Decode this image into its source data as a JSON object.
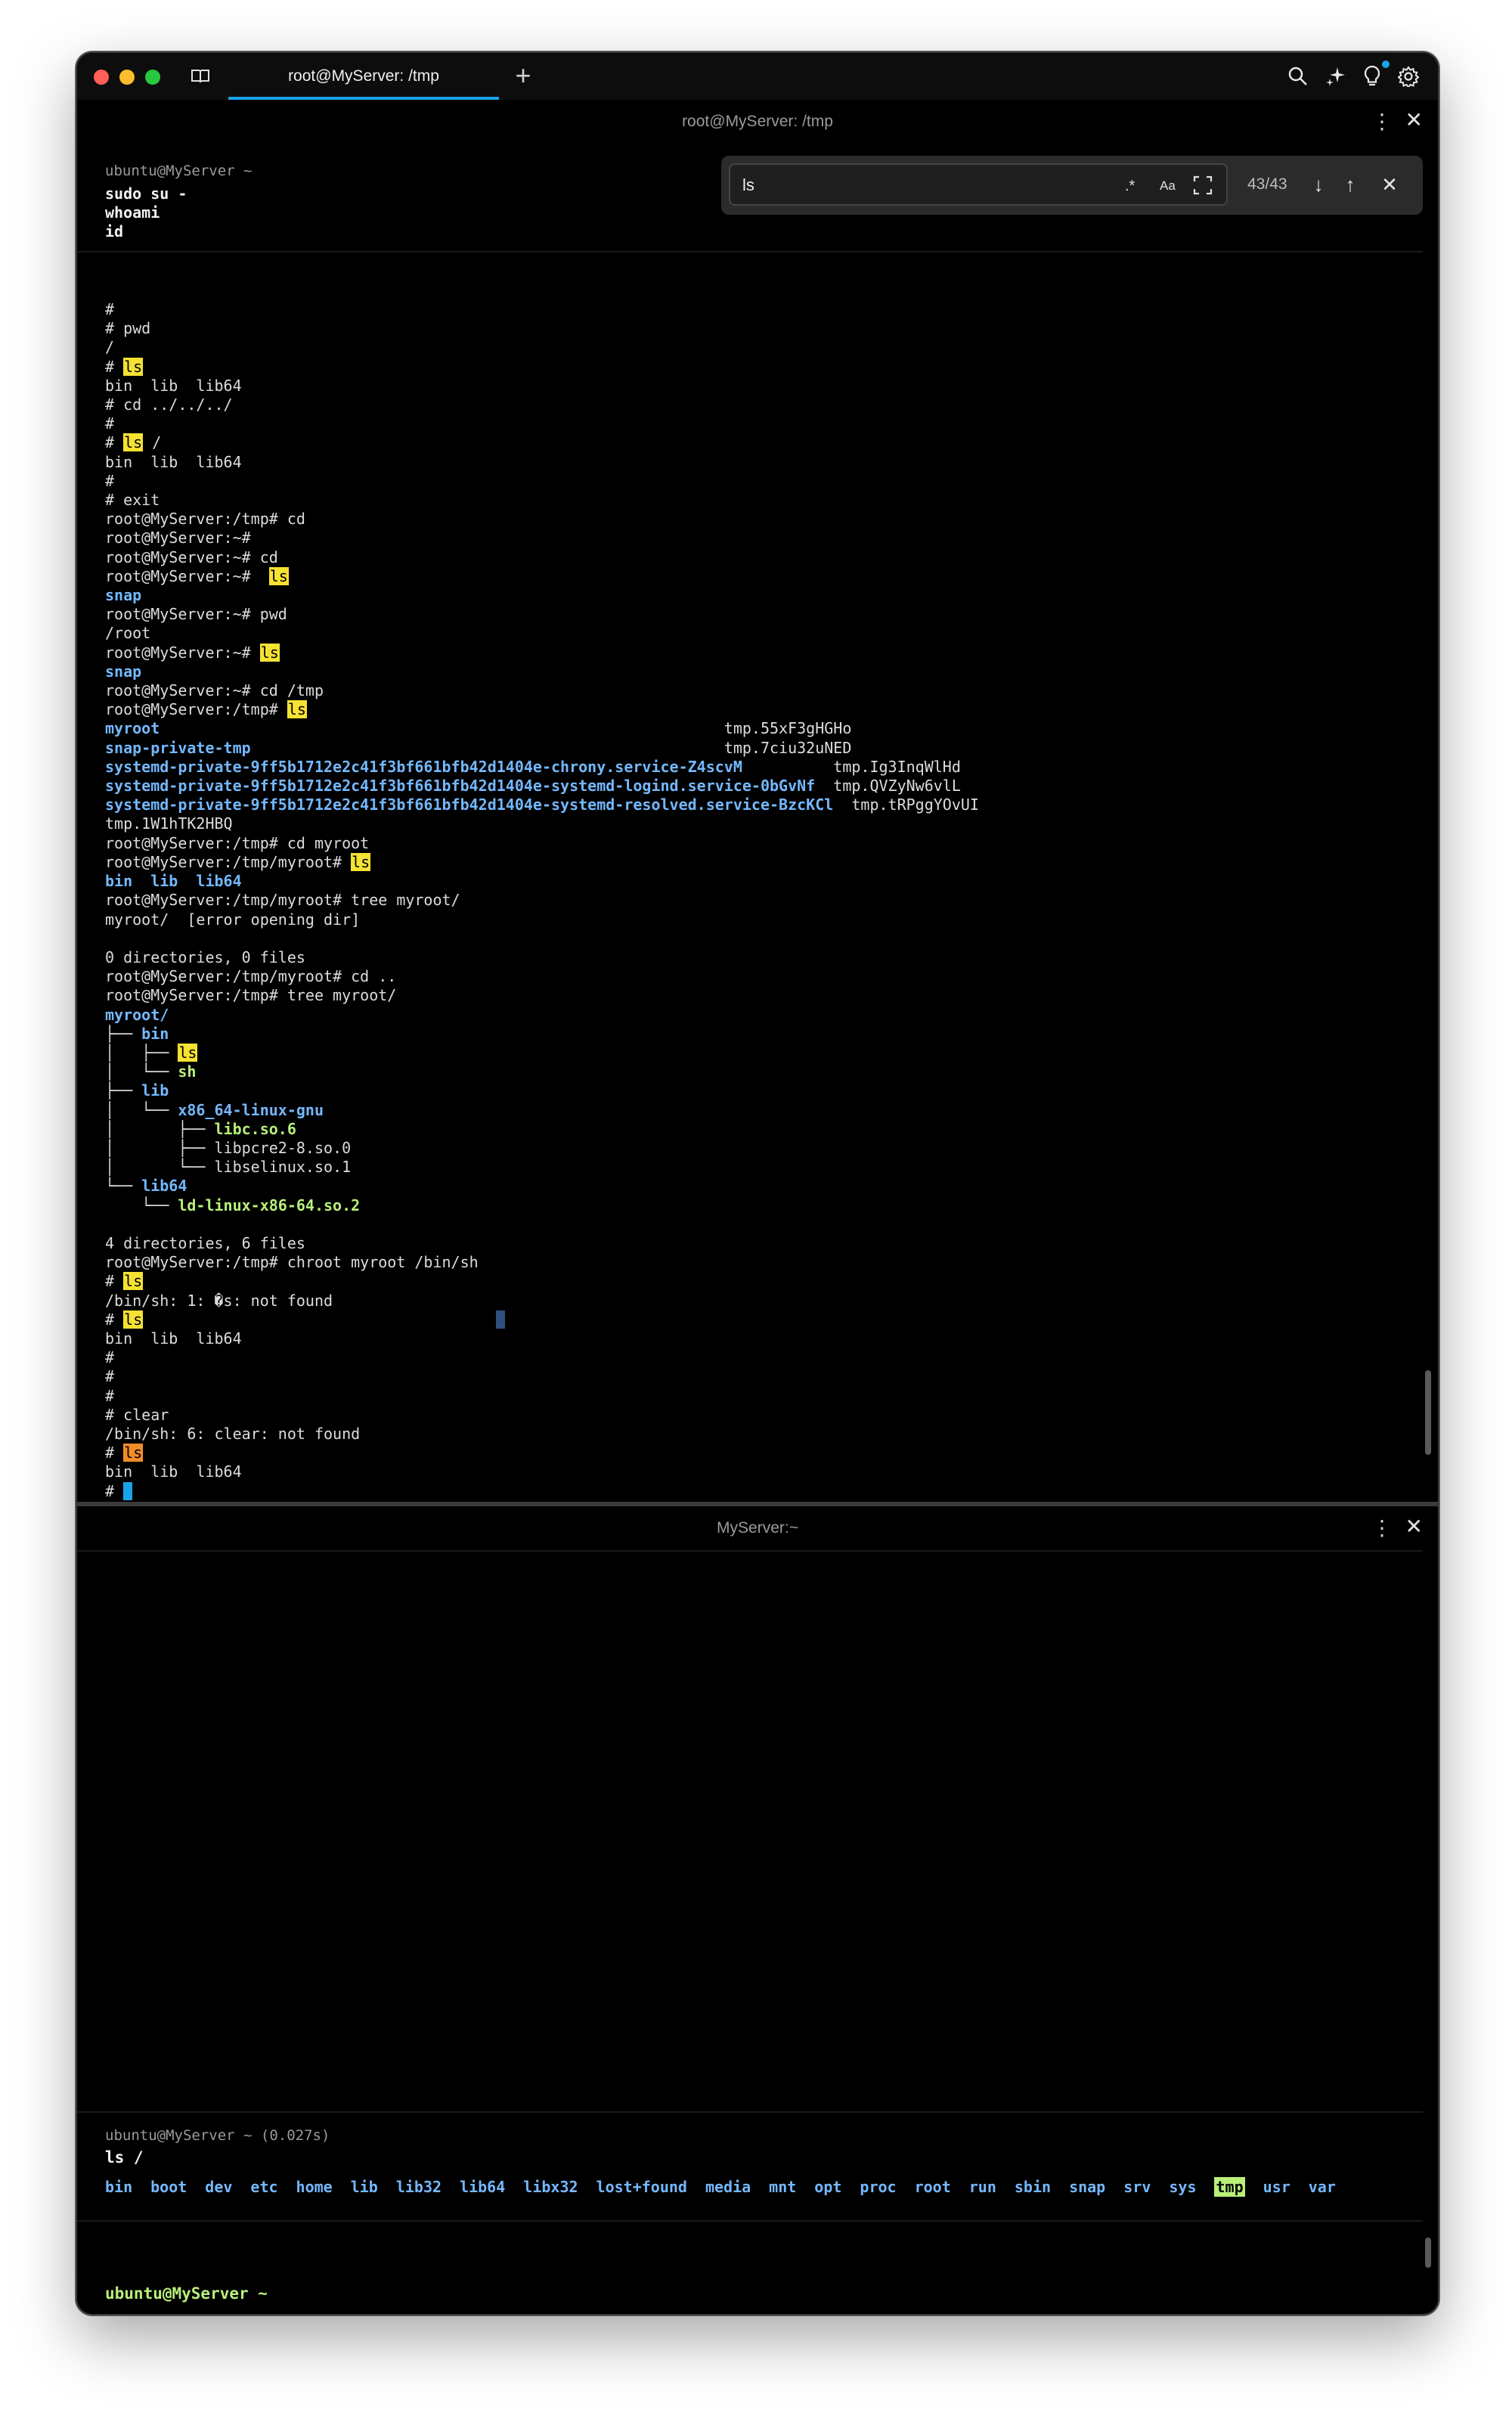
{
  "app": {
    "tab_title": "root@MyServer: /tmp",
    "new_tab_label": "+"
  },
  "icons": {
    "sidebar": "sidebar-icon",
    "search": "search-icon",
    "ai": "sparkle-icon",
    "tips": "lightbulb-icon",
    "settings": "gear-icon"
  },
  "colors": {
    "accent": "#1aa3e8",
    "directory": "#74b8ff",
    "executable": "#b8f07a",
    "match_highlight": "#f5e232",
    "current_match": "#f28c28"
  },
  "top_pane": {
    "title": "root@MyServer: /tmp",
    "block1": {
      "prompt": "ubuntu@MyServer ~",
      "commands": [
        "sudo su -",
        "whoami",
        "id"
      ]
    }
  },
  "find_bar": {
    "query": "ls",
    "regex_label": ".*",
    "case_label": "Aa",
    "count": "43/43"
  },
  "terminal_lines": [
    [
      {
        "t": "#"
      }
    ],
    [
      {
        "t": "# pwd"
      }
    ],
    [
      {
        "t": "/"
      }
    ],
    [
      {
        "t": "# "
      },
      {
        "t": "ls",
        "c": "hl"
      }
    ],
    [
      {
        "t": "bin  lib  lib64"
      }
    ],
    [
      {
        "t": "# cd ../../../"
      }
    ],
    [
      {
        "t": "#"
      }
    ],
    [
      {
        "t": "# "
      },
      {
        "t": "ls",
        "c": "hl"
      },
      {
        "t": " /"
      }
    ],
    [
      {
        "t": "bin  lib  lib64"
      }
    ],
    [
      {
        "t": "#"
      }
    ],
    [
      {
        "t": "# exit"
      }
    ],
    [
      {
        "t": "root@MyServer:/tmp# cd"
      }
    ],
    [
      {
        "t": "root@MyServer:~#"
      }
    ],
    [
      {
        "t": "root@MyServer:~# cd"
      }
    ],
    [
      {
        "t": "root@MyServer:~#  "
      },
      {
        "t": "ls",
        "c": "hl"
      }
    ],
    [
      {
        "t": "snap",
        "c": "b"
      }
    ],
    [
      {
        "t": "root@MyServer:~# pwd"
      }
    ],
    [
      {
        "t": "/root"
      }
    ],
    [
      {
        "t": "root@MyServer:~# "
      },
      {
        "t": "ls",
        "c": "hl"
      }
    ],
    [
      {
        "t": "snap",
        "c": "b"
      }
    ],
    [
      {
        "t": "root@MyServer:~# cd /tmp"
      }
    ],
    [
      {
        "t": "root@MyServer:/tmp# "
      },
      {
        "t": "ls",
        "c": "hl"
      }
    ],
    [
      {
        "t": "myroot                                                              ",
        "c": "b"
      },
      {
        "t": "tmp.55xF3gHGHo"
      }
    ],
    [
      {
        "t": "snap-private-tmp                                                    ",
        "c": "b"
      },
      {
        "t": "tmp.7ciu32uNED"
      }
    ],
    [
      {
        "t": "systemd-private-9ff5b1712e2c41f3bf661bfb42d1404e-chrony.service-Z4scvM          ",
        "c": "b"
      },
      {
        "t": "tmp.Ig3InqWlHd"
      }
    ],
    [
      {
        "t": "systemd-private-9ff5b1712e2c41f3bf661bfb42d1404e-systemd-logind.service-0bGvNf  ",
        "c": "b"
      },
      {
        "t": "tmp.QVZyNw6vlL"
      }
    ],
    [
      {
        "t": "systemd-private-9ff5b1712e2c41f3bf661bfb42d1404e-systemd-resolved.service-BzcKCl",
        "c": "b"
      },
      {
        "t": "  tmp.tRPggYOvUI"
      }
    ],
    [
      {
        "t": "tmp.1W1hTK2HBQ"
      }
    ],
    [
      {
        "t": "root@MyServer:/tmp# cd myroot"
      }
    ],
    [
      {
        "t": "root@MyServer:/tmp/myroot# "
      },
      {
        "t": "ls",
        "c": "hl"
      }
    ],
    [
      {
        "t": "bin  lib  lib64",
        "c": "b"
      }
    ],
    [
      {
        "t": "root@MyServer:/tmp/myroot# tree myroot/"
      }
    ],
    [
      {
        "t": "myroot/  [error opening dir]"
      }
    ],
    [
      {
        "t": ""
      }
    ],
    [
      {
        "t": "0 directories, 0 files"
      }
    ],
    [
      {
        "t": "root@MyServer:/tmp/myroot# cd .."
      }
    ],
    [
      {
        "t": "root@MyServer:/tmp# tree myroot/"
      }
    ],
    [
      {
        "t": "myroot/",
        "c": "b"
      }
    ],
    [
      {
        "t": "├── "
      },
      {
        "t": "bin",
        "c": "b"
      }
    ],
    [
      {
        "t": "│   ├── "
      },
      {
        "t": "ls",
        "c": "hl"
      }
    ],
    [
      {
        "t": "│   └── "
      },
      {
        "t": "sh",
        "c": "g"
      }
    ],
    [
      {
        "t": "├── "
      },
      {
        "t": "lib",
        "c": "b"
      }
    ],
    [
      {
        "t": "│   └── "
      },
      {
        "t": "x86_64-linux-gnu",
        "c": "b"
      }
    ],
    [
      {
        "t": "│       ├── "
      },
      {
        "t": "libc.so.6",
        "c": "g"
      }
    ],
    [
      {
        "t": "│       ├── libpcre2-8.so.0"
      }
    ],
    [
      {
        "t": "│       └── libselinux.so.1"
      }
    ],
    [
      {
        "t": "└── "
      },
      {
        "t": "lib64",
        "c": "b"
      }
    ],
    [
      {
        "t": "    └── "
      },
      {
        "t": "ld-linux-x86-64.so.2",
        "c": "g"
      }
    ],
    [
      {
        "t": ""
      }
    ],
    [
      {
        "t": "4 directories, 6 files"
      }
    ],
    [
      {
        "t": "root@MyServer:/tmp# chroot myroot /bin/sh"
      }
    ],
    [
      {
        "t": "# "
      },
      {
        "t": "ls",
        "c": "hl"
      }
    ],
    [
      {
        "t": "/bin/sh: 1: �s: not found"
      }
    ],
    [
      {
        "t": "# "
      },
      {
        "t": "ls",
        "c": "hl"
      }
    ],
    [
      {
        "t": "bin  lib  lib64"
      }
    ],
    [
      {
        "t": "#"
      }
    ],
    [
      {
        "t": "#"
      }
    ],
    [
      {
        "t": "#"
      }
    ],
    [
      {
        "t": "# clear"
      }
    ],
    [
      {
        "t": "/bin/sh: 6: clear: not found"
      }
    ],
    [
      {
        "t": "# "
      },
      {
        "t": "ls",
        "c": "hl-o"
      }
    ],
    [
      {
        "t": "bin  lib  lib64"
      }
    ],
    [
      {
        "t": "# "
      },
      {
        "t": "",
        "c": "cursor"
      }
    ]
  ],
  "bottom_pane": {
    "title": "MyServer:~",
    "block": {
      "prompt": "ubuntu@MyServer ~ (0.027s)",
      "command": "ls /",
      "output": [
        "bin",
        "boot",
        "dev",
        "etc",
        "home",
        "lib",
        "lib32",
        "lib64",
        "libx32",
        "lost+found",
        "media",
        "mnt",
        "opt",
        "proc",
        "root",
        "run",
        "sbin",
        "snap",
        "srv",
        "sys",
        "tmp",
        "usr",
        "var"
      ],
      "highlighted": "tmp"
    },
    "input_prompt": "ubuntu@MyServer ~"
  }
}
